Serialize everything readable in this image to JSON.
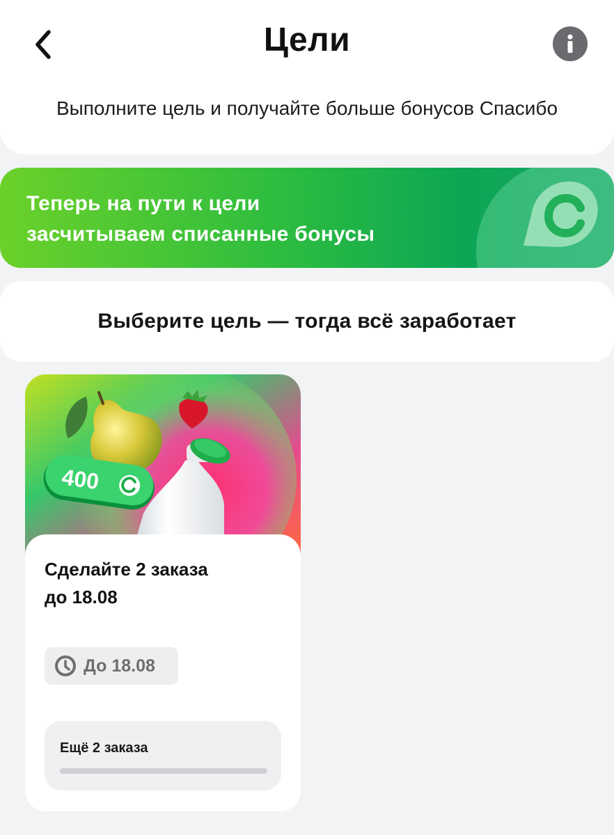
{
  "header": {
    "title": "Цели",
    "subtitle": "Выполните цель и получайте больше бонусов Спасибо"
  },
  "banner": {
    "line1": "Теперь на пути к цели",
    "line2": "засчитываем списанные бонусы"
  },
  "choose": {
    "text": "Выберите цель — тогда всё заработает"
  },
  "goal": {
    "badge_value": "400",
    "title_line1": "Сделайте 2 заказа",
    "title_line2": "до 18.08",
    "deadline": "До 18.08",
    "progress_label": "Ещё 2 заказа",
    "progress_fraction": 0
  },
  "colors": {
    "accent_green": "#2ebd3f",
    "info_icon_bg": "#6b6b6f"
  },
  "icons": {
    "back": "chevron-left-icon",
    "info": "info-icon",
    "brand": "spasibo-logo-icon",
    "clock": "clock-icon"
  }
}
